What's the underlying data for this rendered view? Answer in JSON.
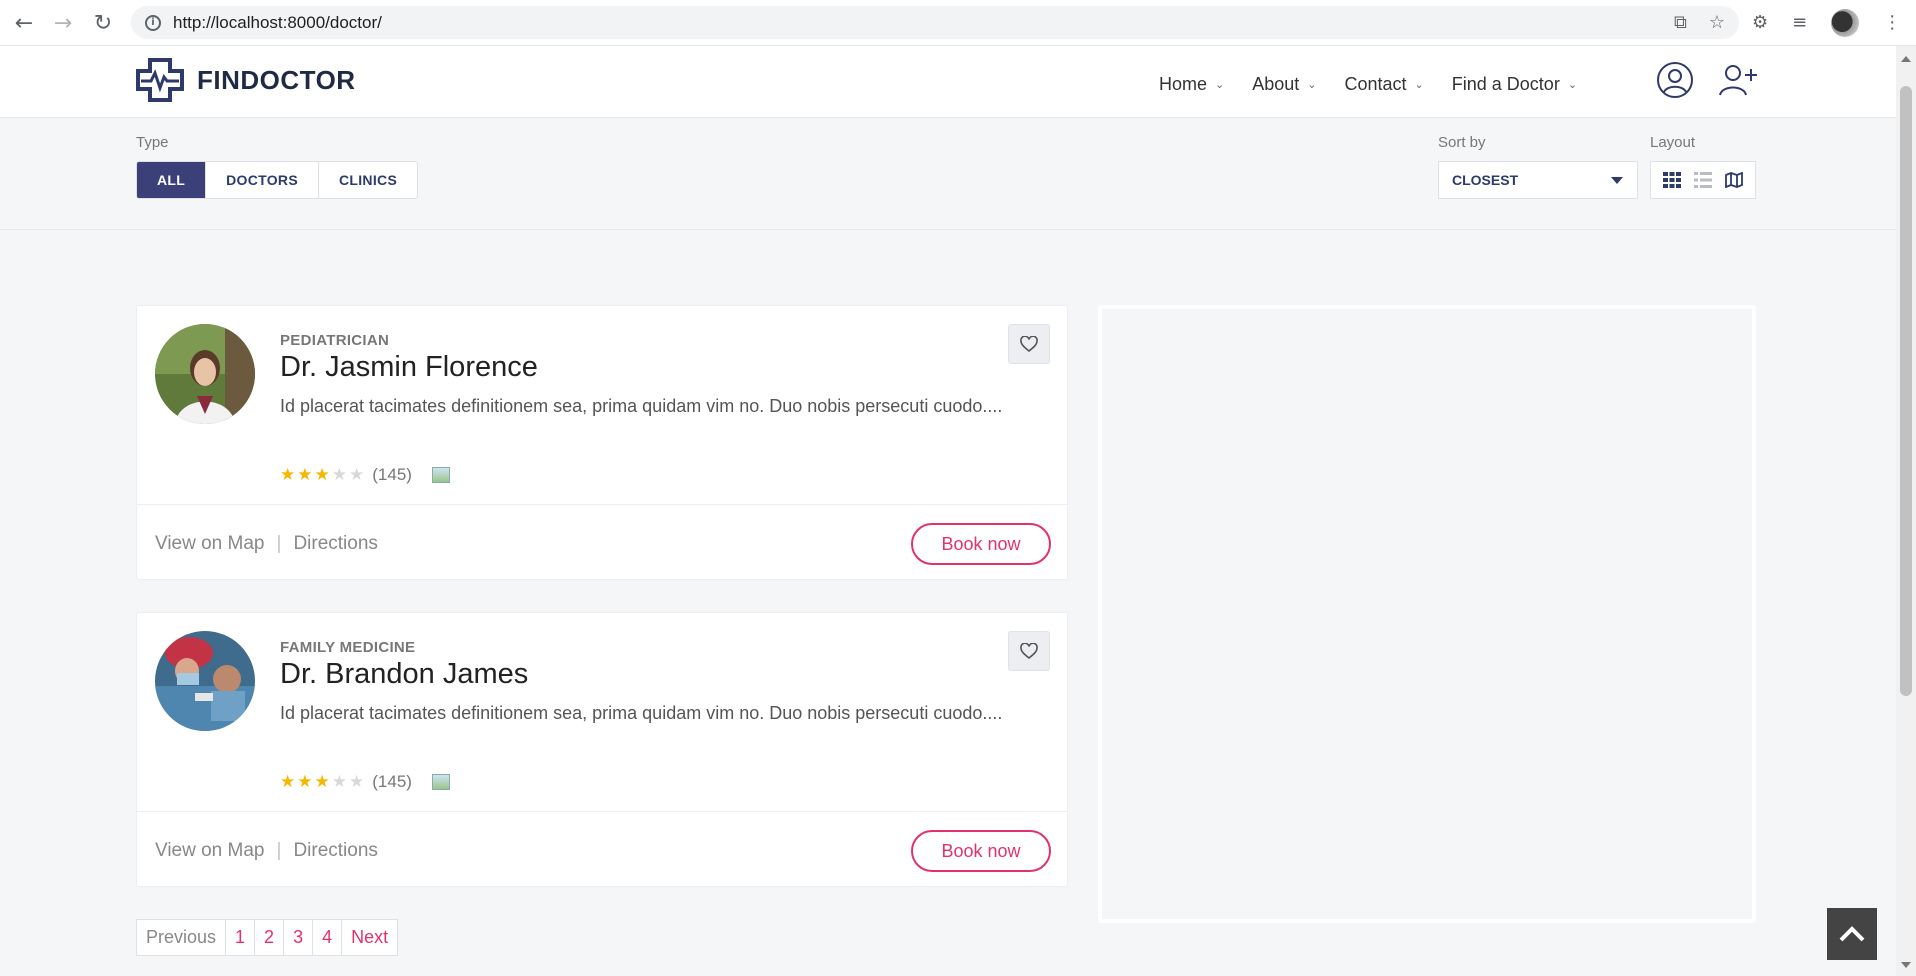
{
  "browser": {
    "url": "http://localhost:8000/doctor/",
    "back_icon": "arrow-left-icon",
    "forward_icon": "arrow-right-icon",
    "reload_icon": "reload-icon"
  },
  "header": {
    "logo_text": "FINDOCTOR",
    "nav": [
      {
        "label": "Home"
      },
      {
        "label": "About"
      },
      {
        "label": "Contact"
      },
      {
        "label": "Find a Doctor"
      }
    ]
  },
  "filters": {
    "type_label": "Type",
    "types": [
      "ALL",
      "DOCTORS",
      "CLINICS"
    ],
    "active_type": "ALL",
    "sort_label": "Sort by",
    "sort_value": "CLOSEST",
    "layout_label": "Layout"
  },
  "doctors": [
    {
      "specialty": "PEDIATRICIAN",
      "name": "Dr. Jasmin Florence",
      "description": "Id placerat tacimates definitionem sea, prima quidam vim no. Duo nobis persecuti cuodo....",
      "rating": 3,
      "rating_max": 5,
      "review_count": "(145)",
      "view_on_map": "View on Map",
      "separator": "|",
      "directions": "Directions",
      "book_label": "Book now"
    },
    {
      "specialty": "FAMILY MEDICINE",
      "name": "Dr. Brandon James",
      "description": "Id placerat tacimates definitionem sea, prima quidam vim no. Duo nobis persecuti cuodo....",
      "rating": 3,
      "rating_max": 5,
      "review_count": "(145)",
      "view_on_map": "View on Map",
      "separator": "|",
      "directions": "Directions",
      "book_label": "Book now"
    }
  ],
  "pagination": {
    "previous": "Previous",
    "pages": [
      "1",
      "2",
      "3",
      "4"
    ],
    "next": "Next"
  },
  "colors": {
    "accent": "#e0336b",
    "brand": "#3b4078",
    "star": "#f5b700"
  }
}
